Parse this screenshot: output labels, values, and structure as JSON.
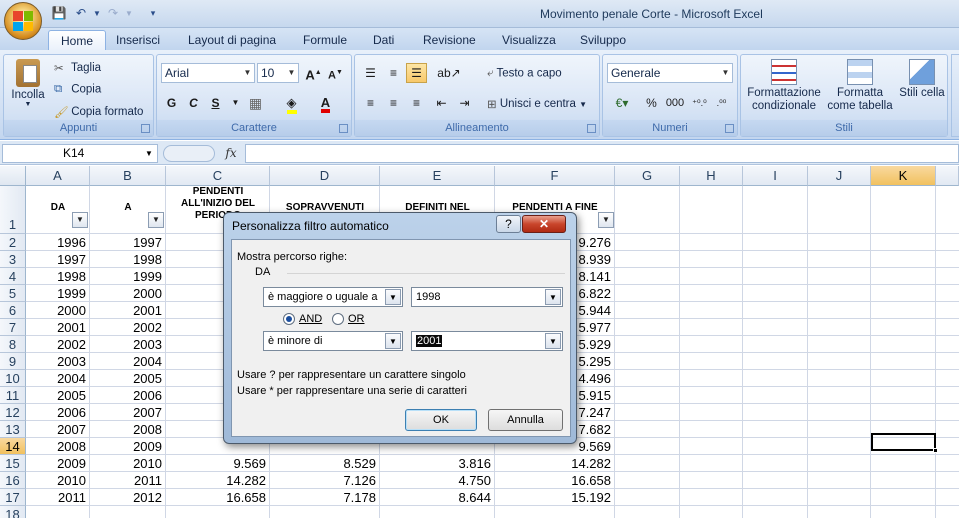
{
  "window": {
    "title": "Movimento penale Corte - Microsoft Excel"
  },
  "tabs": [
    "Home",
    "Inserisci",
    "Layout di pagina",
    "Formule",
    "Dati",
    "Revisione",
    "Visualizza",
    "Sviluppo"
  ],
  "ribbon": {
    "clipboard": {
      "paste": "Incolla",
      "cut": "Taglia",
      "copy": "Copia",
      "format_painter": "Copia formato",
      "label": "Appunti"
    },
    "font": {
      "family": "Arial",
      "size": "10",
      "bold": "G",
      "italic": "C",
      "underline": "S",
      "label": "Carattere"
    },
    "alignment": {
      "wrap": "Testo a capo",
      "merge": "Unisci e centra",
      "label": "Allineamento"
    },
    "number": {
      "format": "Generale",
      "percent": "%",
      "thousands": "000",
      "label": "Numeri"
    },
    "styles": {
      "conditional": "Formattazione condizionale",
      "table": "Formatta come tabella",
      "cell": "Stili cella",
      "label": "Stili"
    }
  },
  "formula_bar": {
    "name_box": "K14",
    "fx": "fx",
    "content": ""
  },
  "columns": [
    "A",
    "B",
    "C",
    "D",
    "E",
    "F",
    "G",
    "H",
    "I",
    "J",
    "K"
  ],
  "rows": [
    "1",
    "2",
    "3",
    "4",
    "5",
    "6",
    "7",
    "8",
    "9",
    "10",
    "11",
    "12",
    "13",
    "14",
    "15",
    "16",
    "17",
    "18"
  ],
  "selected": {
    "column": "K",
    "row": "14"
  },
  "header": {
    "a": "DA",
    "b": "A",
    "c": "PENDENTI ALL'INIZIO DEL PERIODO",
    "d": "SOPRAVVENUTI",
    "e": "DEFINITI NEL",
    "f": "PENDENTI A FINE"
  },
  "data": [
    {
      "a": "1996",
      "b": "1997",
      "c": "",
      "d": "",
      "e": "",
      "f": "9.276"
    },
    {
      "a": "1997",
      "b": "1998",
      "c": "",
      "d": "",
      "e": "",
      "f": "8.939"
    },
    {
      "a": "1998",
      "b": "1999",
      "c": "",
      "d": "",
      "e": "",
      "f": "8.141"
    },
    {
      "a": "1999",
      "b": "2000",
      "c": "",
      "d": "",
      "e": "",
      "f": "6.822"
    },
    {
      "a": "2000",
      "b": "2001",
      "c": "",
      "d": "",
      "e": "",
      "f": "5.944"
    },
    {
      "a": "2001",
      "b": "2002",
      "c": "",
      "d": "",
      "e": "",
      "f": "5.977"
    },
    {
      "a": "2002",
      "b": "2003",
      "c": "",
      "d": "",
      "e": "",
      "f": "5.929"
    },
    {
      "a": "2003",
      "b": "2004",
      "c": "",
      "d": "",
      "e": "",
      "f": "5.295"
    },
    {
      "a": "2004",
      "b": "2005",
      "c": "",
      "d": "",
      "e": "",
      "f": "4.496"
    },
    {
      "a": "2005",
      "b": "2006",
      "c": "",
      "d": "",
      "e": "",
      "f": "5.915"
    },
    {
      "a": "2006",
      "b": "2007",
      "c": "",
      "d": "",
      "e": "",
      "f": "7.247"
    },
    {
      "a": "2007",
      "b": "2008",
      "c": "",
      "d": "",
      "e": "",
      "f": "7.682"
    },
    {
      "a": "2008",
      "b": "2009",
      "c": "",
      "d": "",
      "e": "",
      "f": "9.569"
    },
    {
      "a": "2009",
      "b": "2010",
      "c": "9.569",
      "d": "8.529",
      "e": "3.816",
      "f": "14.282"
    },
    {
      "a": "2010",
      "b": "2011",
      "c": "14.282",
      "d": "7.126",
      "e": "4.750",
      "f": "16.658"
    },
    {
      "a": "2011",
      "b": "2012",
      "c": "16.658",
      "d": "7.178",
      "e": "8.644",
      "f": "15.192"
    }
  ],
  "dialog": {
    "title": "Personalizza filtro automatico",
    "help": "?",
    "close": "✕",
    "show_rows": "Mostra percorso righe:",
    "field": "DA",
    "cond1_op": "è maggiore o uguale a",
    "cond1_val": "1998",
    "and_label": "AND",
    "or_label": "OR",
    "cond2_op": "è minore di",
    "cond2_val": "2001",
    "hint1": "Usare ? per rappresentare un carattere singolo",
    "hint2": "Usare * per rappresentare una serie di caratteri",
    "ok": "OK",
    "cancel": "Annulla"
  }
}
